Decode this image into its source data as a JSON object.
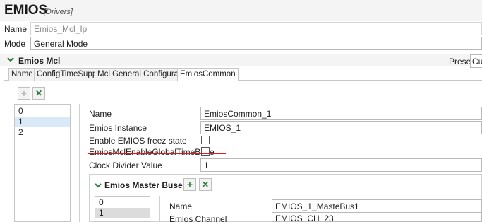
{
  "header": {
    "title": "EMIOS",
    "subtitle": "[Drivers]"
  },
  "form": {
    "name_label": "Name",
    "name_value": "Emios_Mcl_Ip",
    "mode_label": "Mode",
    "mode_value": "General Mode"
  },
  "section": {
    "title": "Emios Mcl",
    "preset_label": "Preset",
    "preset_value": "Cu"
  },
  "tabs": [
    {
      "label": "Name",
      "active": false
    },
    {
      "label": "ConfigTimeSupport",
      "active": false
    },
    {
      "label": "Mcl General Configuration",
      "active": false
    },
    {
      "label": "EmiosCommon",
      "active": true
    }
  ],
  "toolbar": {
    "add_glyph": "+",
    "remove_glyph": "✕"
  },
  "common_list": {
    "items": [
      "0",
      "1",
      "2"
    ],
    "selected_index": 1
  },
  "common_props": {
    "name_label": "Name",
    "name_value": "EmiosCommon_1",
    "instance_label": "Emios Instance",
    "instance_value": "EMIOS_1",
    "freez_label": "Enable EMIOS freez state",
    "freez_checked": false,
    "global_tb_label": "EmiosMclEnableGlobalTimeBase",
    "global_tb_checked": false,
    "divider_label": "Clock Divider Value",
    "divider_value": "1"
  },
  "master_buses": {
    "title": "Emios Master Buses",
    "items": [
      "0",
      "1"
    ],
    "selected_index": 1,
    "name_label": "Name",
    "name_value": "EMIOS_1_MasteBus1",
    "channel_label": "Emios Channel",
    "channel_value": "EMIOS_CH_23"
  },
  "colors": {
    "accent_green": "#2b7a3a",
    "annotation_red": "#d42020",
    "selection_blue": "#d9e9f7"
  }
}
